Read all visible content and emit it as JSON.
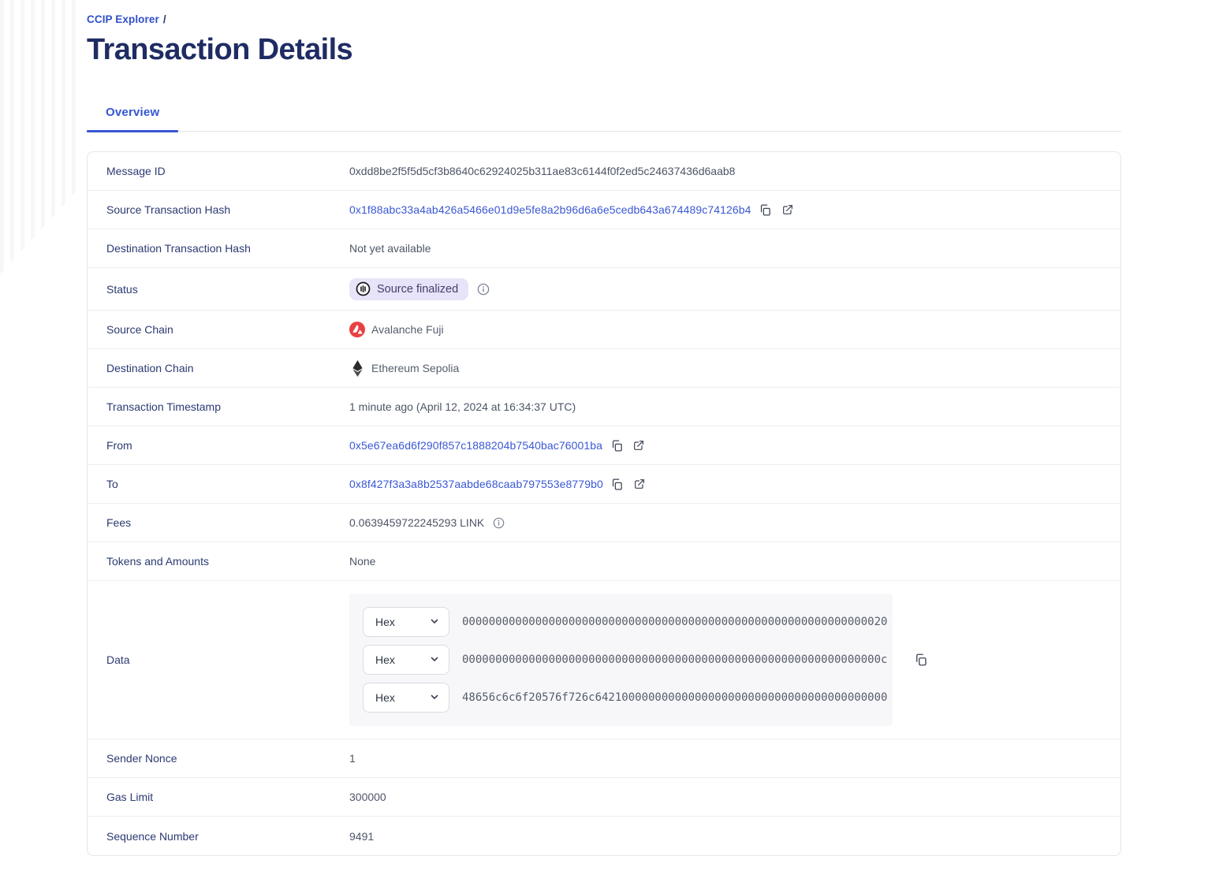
{
  "breadcrumb": {
    "link_label": "CCIP Explorer",
    "separator": "/"
  },
  "page_title": "Transaction Details",
  "tabs": {
    "overview": "Overview"
  },
  "details": {
    "message_id": {
      "label": "Message ID",
      "value": "0xdd8be2f5f5d5cf3b8640c62924025b311ae83c6144f0f2ed5c24637436d6aab8"
    },
    "source_tx_hash": {
      "label": "Source Transaction Hash",
      "value": "0x1f88abc33a4ab426a5466e01d9e5fe8a2b96d6a6e5cedb643a674489c74126b4"
    },
    "dest_tx_hash": {
      "label": "Destination Transaction Hash",
      "value": "Not yet available"
    },
    "status": {
      "label": "Status",
      "value": "Source finalized"
    },
    "source_chain": {
      "label": "Source Chain",
      "value": "Avalanche Fuji"
    },
    "dest_chain": {
      "label": "Destination Chain",
      "value": "Ethereum Sepolia"
    },
    "timestamp": {
      "label": "Transaction Timestamp",
      "value": "1 minute ago (April 12, 2024 at 16:34:37 UTC)"
    },
    "from": {
      "label": "From",
      "value": "0x5e67ea6d6f290f857c1888204b7540bac76001ba"
    },
    "to": {
      "label": "To",
      "value": "0x8f427f3a3a8b2537aabde68caab797553e8779b0"
    },
    "fees": {
      "label": "Fees",
      "value": "0.0639459722245293 LINK"
    },
    "tokens_and_amounts": {
      "label": "Tokens and Amounts",
      "value": "None"
    },
    "data": {
      "label": "Data",
      "encoding": "Hex",
      "lines": [
        "0000000000000000000000000000000000000000000000000000000000000020",
        "000000000000000000000000000000000000000000000000000000000000000c",
        "48656c6c6f20576f726c64210000000000000000000000000000000000000000"
      ]
    },
    "sender_nonce": {
      "label": "Sender Nonce",
      "value": "1"
    },
    "gas_limit": {
      "label": "Gas Limit",
      "value": "300000"
    },
    "sequence_number": {
      "label": "Sequence Number",
      "value": "9491"
    }
  },
  "colors": {
    "accent_blue": "#3a57d0",
    "link_blue": "#3a58d5",
    "heading_navy": "#1f2c63",
    "badge_bg": "#e7e3f8",
    "badge_text": "#453e6b",
    "avalanche_red": "#e84142",
    "ethereum_black": "#2b2b2b"
  },
  "icons": {
    "copy": "copy-icon",
    "external_link": "external-link-icon",
    "info": "info-icon",
    "status_finalized": "finalized-circle-icon",
    "chevron_down": "chevron-down-icon"
  }
}
